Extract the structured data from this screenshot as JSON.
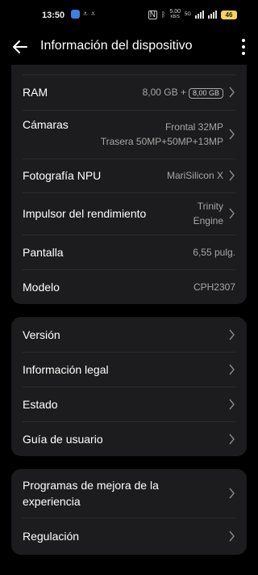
{
  "status_bar": {
    "time": "13:50",
    "nfc": "N",
    "speed": "5,00",
    "speed_unit": "KB/S",
    "network": "5G",
    "battery": "46",
    "battery_color": "#f5d35c"
  },
  "header": {
    "title": "Información del dispositivo"
  },
  "specs": [
    {
      "label": "RAM",
      "value": "8,00 GB +",
      "badge": "8,00 GB",
      "chevron": true
    },
    {
      "label": "Cámaras",
      "value": "Frontal 32MP",
      "value2": "Trasera 50MP+50MP+13MP",
      "chevron": true
    },
    {
      "label": "Fotografía NPU",
      "value": "MariSilicon X",
      "chevron": true
    },
    {
      "label": "Impulsor del rendimiento",
      "value": "Trinity",
      "value2": "Engine",
      "chevron": true
    },
    {
      "label": "Pantalla",
      "value": "6,55 pulg."
    },
    {
      "label": "Modelo",
      "value": "CPH2307"
    }
  ],
  "info_items": [
    {
      "label": "Versión"
    },
    {
      "label": "Información legal"
    },
    {
      "label": "Estado"
    },
    {
      "label": "Guía de usuario"
    }
  ],
  "extra_items": [
    {
      "label": "Programas de mejora de la experiencia"
    },
    {
      "label": "Regulación"
    }
  ],
  "colors": {
    "background": "#000000",
    "card": "#1c1c1e",
    "secondary_text": "#a6a6a6",
    "app_icon": "#3d7fe6"
  }
}
